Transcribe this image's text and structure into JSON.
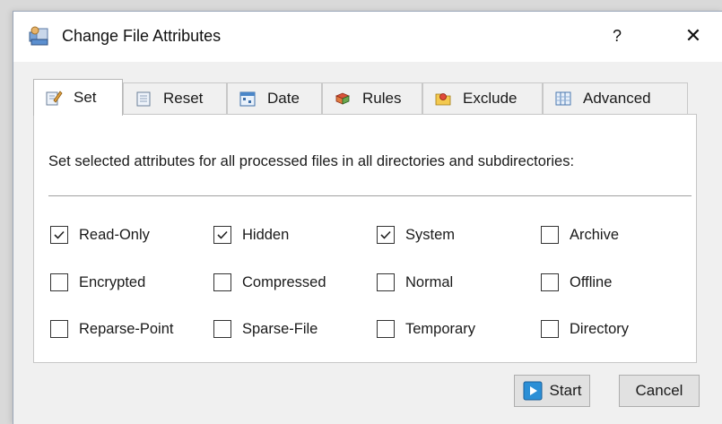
{
  "window": {
    "title": "Change File Attributes",
    "help_label": "?",
    "close_label": "✕"
  },
  "tabs": [
    {
      "label": "Set",
      "icon": "set-icon",
      "active": true
    },
    {
      "label": "Reset",
      "icon": "reset-icon",
      "active": false
    },
    {
      "label": "Date",
      "icon": "date-icon",
      "active": false
    },
    {
      "label": "Rules",
      "icon": "rules-icon",
      "active": false
    },
    {
      "label": "Exclude",
      "icon": "exclude-icon",
      "active": false
    },
    {
      "label": "Advanced",
      "icon": "advanced-icon",
      "active": false
    }
  ],
  "panel": {
    "description": "Set selected attributes for all processed files in all directories and subdirectories:"
  },
  "attributes": [
    {
      "label": "Read-Only",
      "checked": true
    },
    {
      "label": "Hidden",
      "checked": true
    },
    {
      "label": "System",
      "checked": true
    },
    {
      "label": "Archive",
      "checked": false
    },
    {
      "label": "Encrypted",
      "checked": false
    },
    {
      "label": "Compressed",
      "checked": false
    },
    {
      "label": "Normal",
      "checked": false
    },
    {
      "label": "Offline",
      "checked": false
    },
    {
      "label": "Reparse-Point",
      "checked": false
    },
    {
      "label": "Sparse-File",
      "checked": false
    },
    {
      "label": "Temporary",
      "checked": false
    },
    {
      "label": "Directory",
      "checked": false
    }
  ],
  "buttons": {
    "start_label": "Start",
    "cancel_label": "Cancel"
  },
  "colors": {
    "titlebar": "#ffffff",
    "dialog_bg": "#f0f0f0",
    "panel_bg": "#ffffff",
    "start_icon": "#2b8fd6"
  }
}
